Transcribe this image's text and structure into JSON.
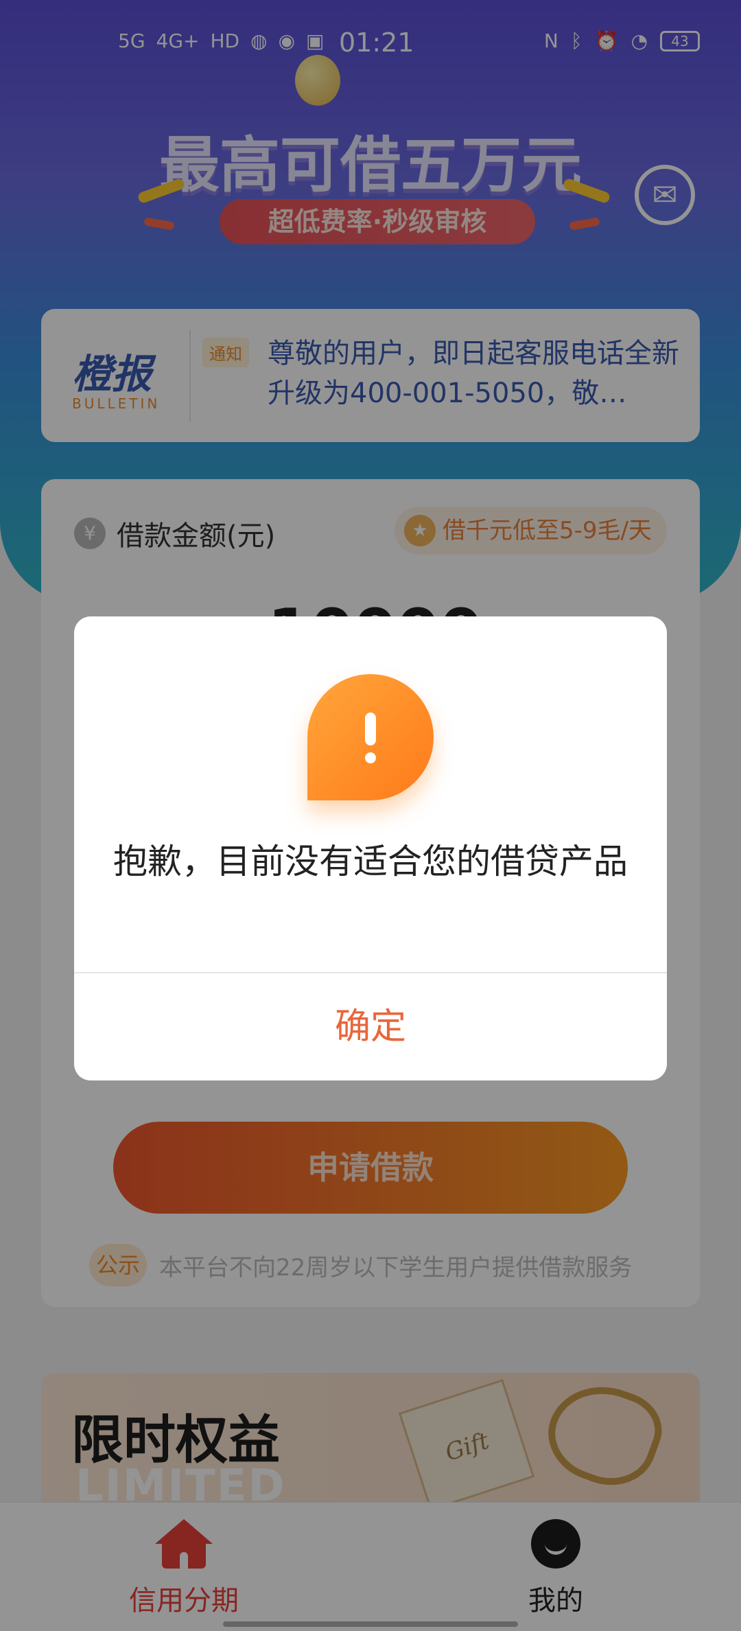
{
  "status_bar": {
    "signal_left": "5G",
    "signal_left2": "4G+",
    "hd": "HD",
    "time": "01:21",
    "battery": "43"
  },
  "hero": {
    "title": "最高可借五万元",
    "pill": "超低费率·秒级审核"
  },
  "bulletin": {
    "logo_main": "橙报",
    "logo_sub": "BULLETIN",
    "tag": "通知",
    "text": "尊敬的用户，即日起客服电话全新升级为400-001-5050，敬…"
  },
  "loan": {
    "label": "借款金额(元)",
    "rate_badge": "借千元低至5-9毛/天",
    "amount": "10000",
    "apply_button": "申请借款",
    "notice_tag": "公示",
    "notice_text": "本平台不向22周岁以下学生用户提供借款服务"
  },
  "limited": {
    "title": "限时权益",
    "subtitle": "LIMITED",
    "gift_text": "Gift"
  },
  "bottom_nav": {
    "items": [
      {
        "label": "信用分期",
        "icon": "home-icon"
      },
      {
        "label": "我的",
        "icon": "profile-icon"
      }
    ]
  },
  "dialog": {
    "message": "抱歉，目前没有适合您的借贷产品",
    "ok_button": "确定"
  },
  "colors": {
    "accent": "#e8413a",
    "button_gradient_start": "#f0572e",
    "button_gradient_end": "#fb9a24",
    "dialog_ok": "#e8663a"
  }
}
